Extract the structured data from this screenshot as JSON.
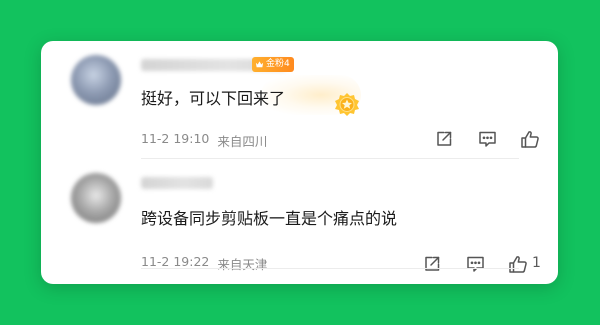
{
  "comments": [
    {
      "badge": "金粉4",
      "text": "挺好，可以下回来了",
      "time": "11-2 19:10",
      "location": "来自四川",
      "likes": ""
    },
    {
      "text": "跨设备同步剪贴板一直是个痛点的说",
      "time": "11-2 19:22",
      "location": "来自天津",
      "likes": "1"
    }
  ],
  "colors": {
    "background": "#12c25e",
    "badge": "#ff9a24",
    "text": "#1a1a1a",
    "meta": "#8a8a8a"
  }
}
